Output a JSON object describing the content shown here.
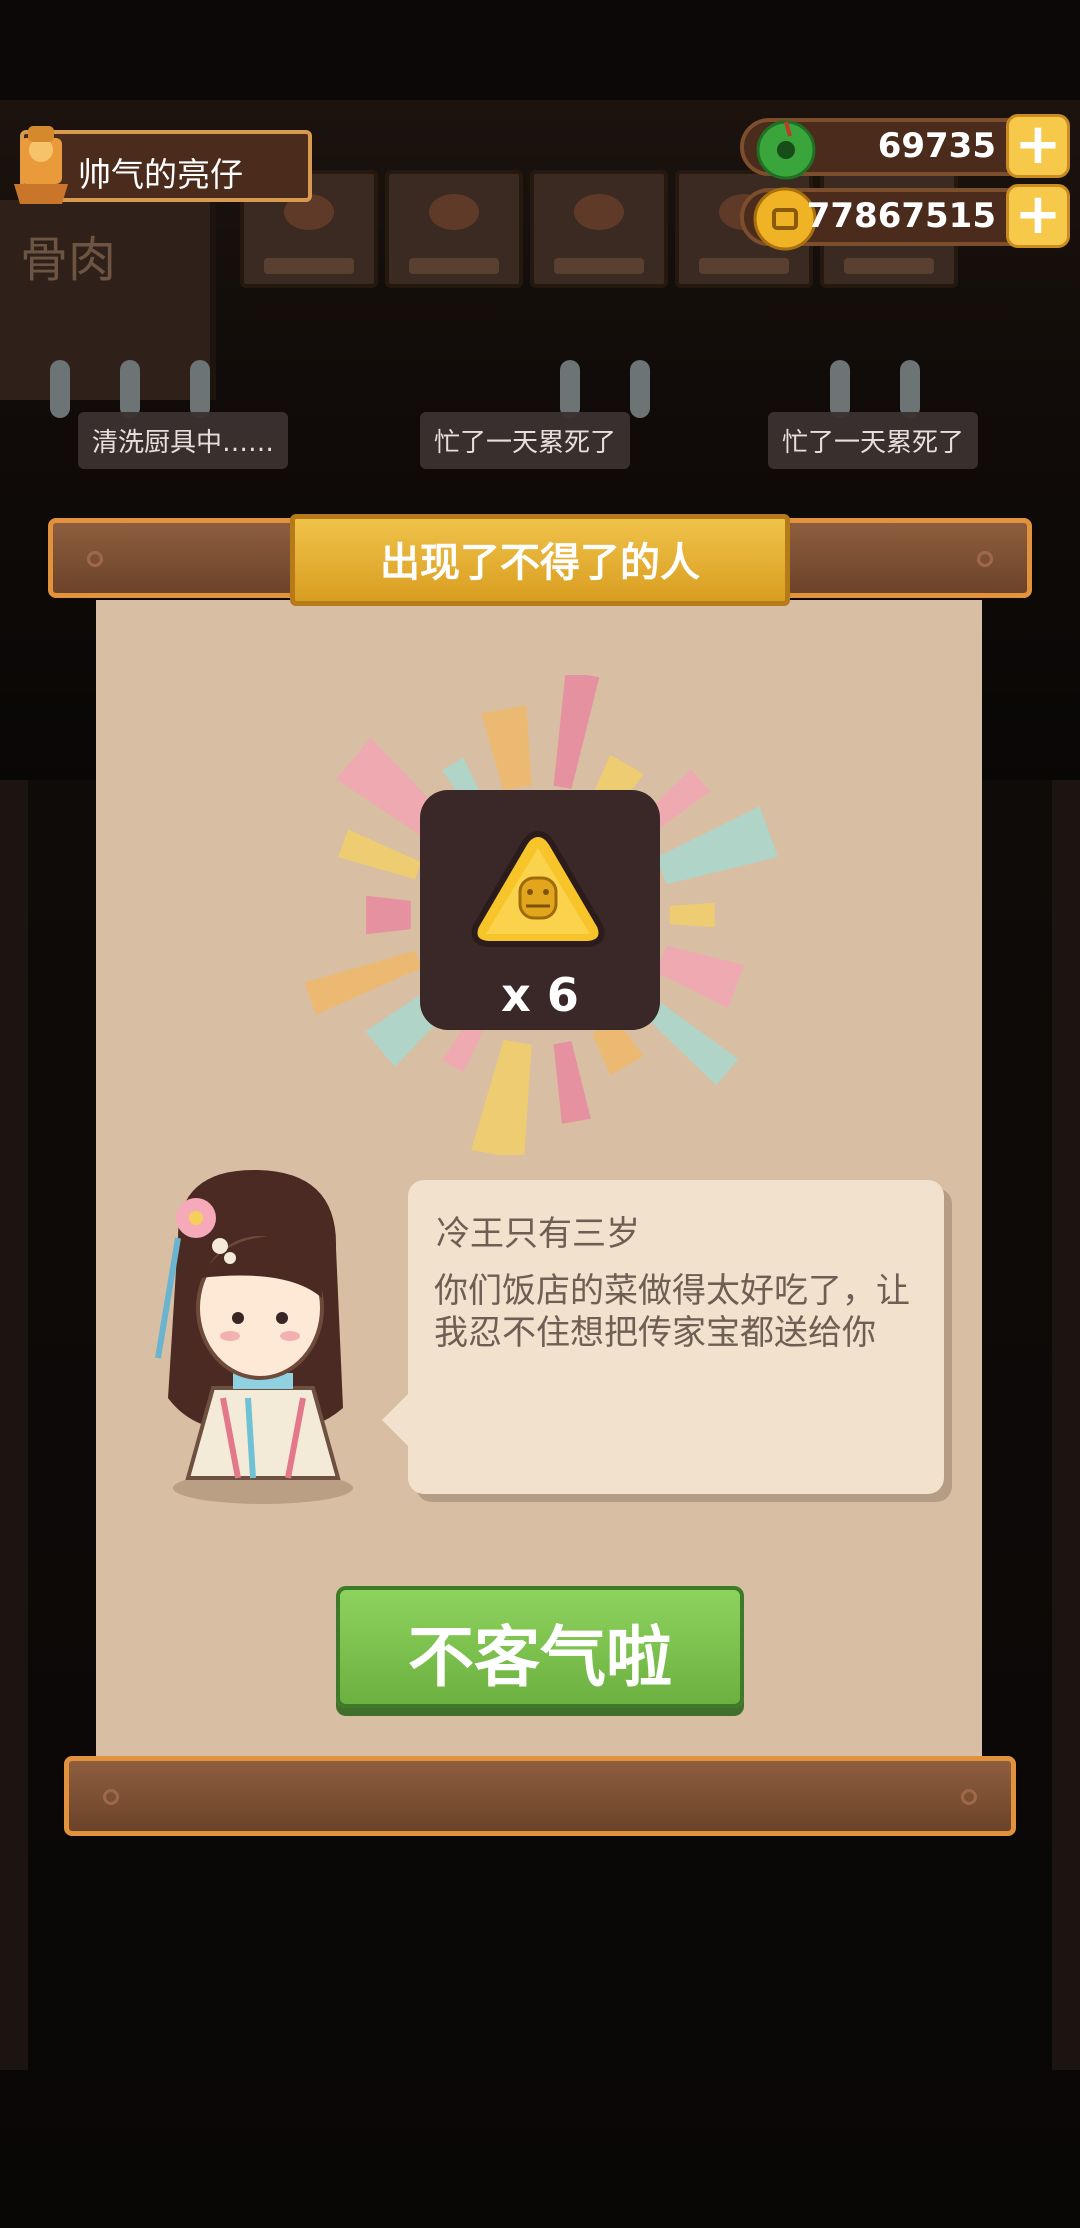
{
  "player": {
    "name": "帅气的亮仔"
  },
  "currencies": {
    "jade": {
      "value": "69735"
    },
    "coins": {
      "value": "77867515"
    }
  },
  "background": {
    "sign_text": "骨肉",
    "bubbles": [
      "清洗厨具中……",
      "忙了一天累死了",
      "忙了一天累死了"
    ]
  },
  "modal": {
    "title": "出现了不得了的人",
    "reward": {
      "icon": "golden-triangle-token-icon",
      "count": "x 6"
    },
    "dialog": {
      "speaker": "冷王只有三岁",
      "message": "你们饭店的菜做得太好吃了，让我忍不住想把传家宝都送给你"
    },
    "confirm_button": "不客气啦"
  },
  "colors": {
    "paper": "#d8bea3",
    "plaque": "#e8b33a",
    "button_green": "#7cc24e",
    "wood": "#6b4329"
  }
}
